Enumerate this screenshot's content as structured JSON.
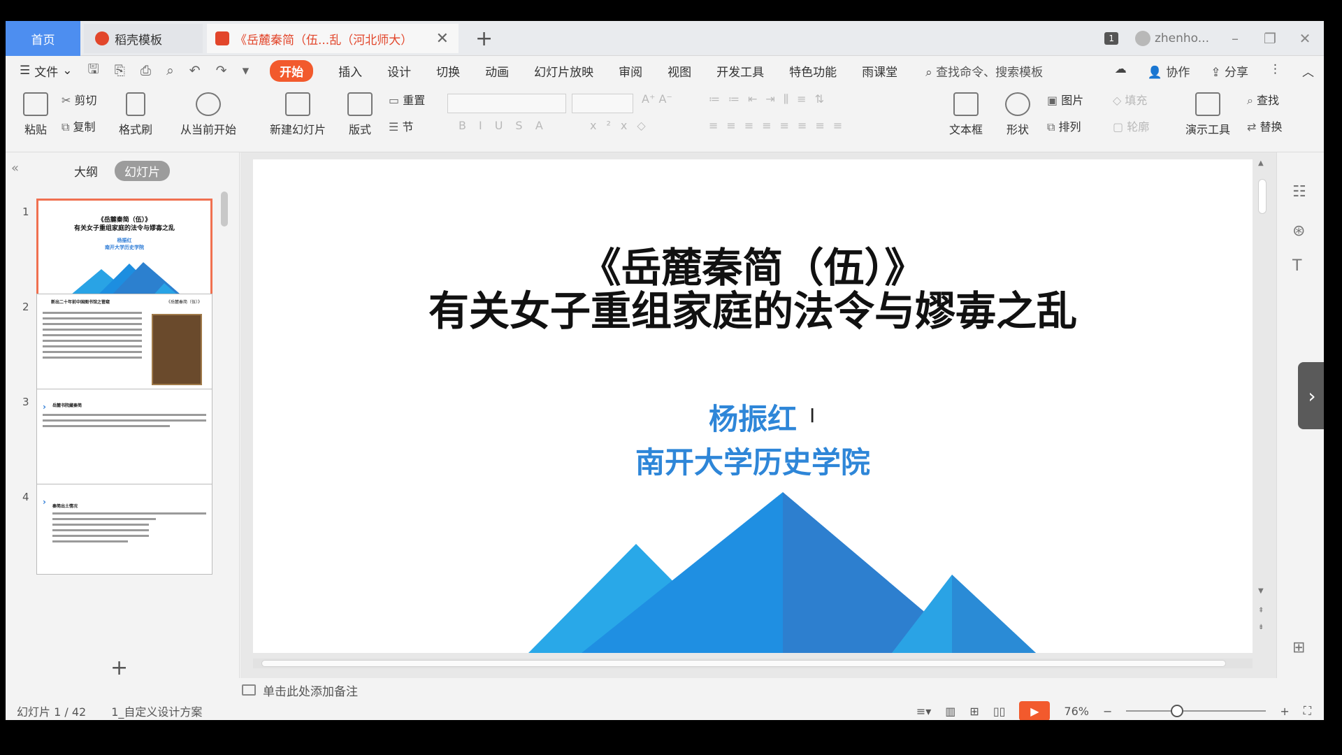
{
  "titlebar": {
    "home_tab": "首页",
    "template_tab": "稻壳模板",
    "doc_tab": "《岳麓秦简（伍...乱（河北师大）",
    "close": "✕",
    "new_tab": "+",
    "badge": "1",
    "user": "zhenho...",
    "minimize": "–",
    "restore": "❐",
    "close_window": "✕"
  },
  "menu": {
    "file": "文件",
    "items": [
      "开始",
      "插入",
      "设计",
      "切换",
      "动画",
      "幻灯片放映",
      "审阅",
      "视图",
      "开发工具",
      "特色功能",
      "雨课堂"
    ],
    "search": "查找命令、搜索模板",
    "collab": "协作",
    "share": "分享"
  },
  "ribbon": {
    "paste": "粘贴",
    "cut": "剪切",
    "copy": "复制",
    "format_painter": "格式刷",
    "from_current": "从当前开始",
    "new_slide": "新建幻灯片",
    "layout": "版式",
    "reset": "重置",
    "section": "节",
    "textbox": "文本框",
    "shape": "形状",
    "picture": "图片",
    "arrange": "排列",
    "fill": "填充",
    "outline": "轮廓",
    "present_tools": "演示工具",
    "find": "查找",
    "replace": "替换"
  },
  "leftpanel": {
    "outline_tab": "大纲",
    "slides_tab": "幻灯片",
    "thumbs": [
      {
        "num": "1",
        "title1": "《岳麓秦简（伍）》",
        "title2": "有关女子重组家庭的法令与嫪毐之乱",
        "author": "杨振红",
        "school": "南开大学历史学院"
      },
      {
        "num": "2",
        "heading": "新出二十年前中国图书馆之管窥",
        "side": "《岳麓秦简（伍）》"
      },
      {
        "num": "3",
        "heading": "岳麓书院藏秦简"
      },
      {
        "num": "4",
        "heading": "秦简出土情况"
      }
    ],
    "add": "+"
  },
  "slide": {
    "title1": "《岳麓秦简（伍）》",
    "title2": "有关女子重组家庭的法令与嫪毐之乱",
    "author": "杨振红",
    "school": "南开大学历史学院",
    "accent": "#2e86d8"
  },
  "notes": {
    "placeholder": "单击此处添加备注"
  },
  "status": {
    "slide_counter": "幻灯片 1 / 42",
    "design": "1_自定义设计方案",
    "zoom": "76%"
  }
}
